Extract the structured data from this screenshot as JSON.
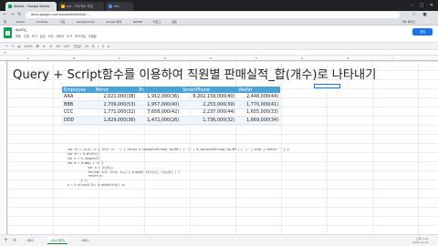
{
  "browser": {
    "tabs": [
      {
        "label": "Sheets - Google Sheets",
        "active": true
      },
      {
        "label": "ppt - 프로젝트 파일",
        "active": false
      },
      {
        "label": "tab",
        "active": false
      }
    ],
    "url": "docs.google.com/spreadsheets/d/...",
    "bookmarks": [
      "앱",
      "Gmail",
      "YouTube",
      "지도",
      "Google Drive",
      "Google 번역",
      "NAVER",
      "블로그",
      "설정",
      "기타 북마크"
    ]
  },
  "sheets": {
    "title": "query_",
    "menu": [
      "파일",
      "수정",
      "보기",
      "삽입",
      "서식",
      "데이터",
      "도구",
      "부가기능",
      "도움말"
    ],
    "share_label": "공유",
    "toolbar_text": "↶ ↷ 🖶  100%  ₩ % .0 .00 123  기본값  10  B I S A",
    "formula_prefix": "fx",
    "columns": [
      "A",
      "B",
      "C",
      "D",
      "E",
      "F",
      "G",
      "H",
      "I"
    ]
  },
  "heading": "Query + Script함수를 이용하여 직원별 판매실적_합(개수)로 나타내기",
  "table": {
    "headers": [
      "Employee",
      "Mirror",
      "Pc",
      "SmartPhone",
      "Wallet"
    ],
    "rows": [
      [
        "AAA",
        "2,021,000(38)",
        "1,912,000(36)",
        "6,202,159,000(40)",
        "2,448,000(44)"
      ],
      [
        "BBB",
        "2,709,000(53)",
        "1,957,000(40)",
        "2,253,000(39)",
        "1,770,000(41)"
      ],
      [
        "CCC",
        "1,771,000(32)",
        "7,658,000(42)",
        "2,237,000(44)",
        "1,655,000(33)"
      ],
      [
        "DDD",
        "1,829,000(36)",
        "1,472,000(26)",
        "1,736,000(32)",
        "1,669,000(34)"
      ]
    ]
  },
  "code_lines": [
    "var fx = (a,b) => { if(a !== '') { return a.toLocaleString('ko-KR') + '(' + b.toLocaleString('ko-KR') + ')' } else { return '' } };",
    "var hr = h.shift();",
    "var n = h.length/2;",
    "",
    "var b = d.map( r => {",
    "            var a = [r[0]];",
    "            for(var i=1; i<=n; i++) { a.push( fx(r[i], r[i+n]) ) }",
    "            return a;",
    "        } );",
    "h = h.slice(0,5); b.unshift(h); b;"
  ],
  "sheet_tabs": [
    "시트1",
    "시트2(결과)",
    "시트3"
  ],
  "clock": {
    "time": "오후 3:12",
    "date": "2021-01-19"
  }
}
